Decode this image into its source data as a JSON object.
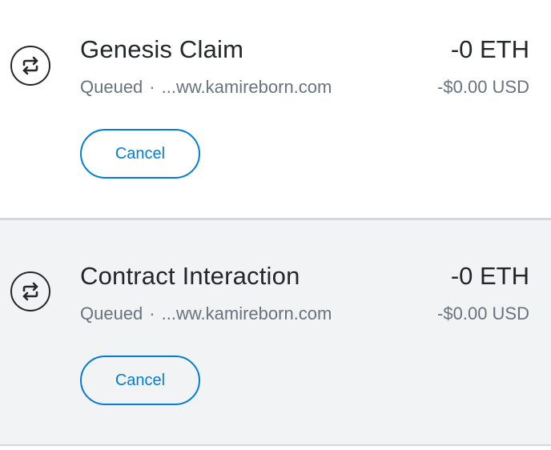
{
  "transactions": [
    {
      "title": "Genesis Claim",
      "status": "Queued",
      "separator": "·",
      "origin": "...ww.kamireborn.com",
      "amount": "-0 ETH",
      "fiat": "-$0.00 USD",
      "cancel_label": "Cancel",
      "icon": "swap-arrows-icon"
    },
    {
      "title": "Contract Interaction",
      "status": "Queued",
      "separator": "·",
      "origin": "...ww.kamireborn.com",
      "amount": "-0 ETH",
      "fiat": "-$0.00 USD",
      "cancel_label": "Cancel",
      "icon": "swap-arrows-icon"
    }
  ],
  "colors": {
    "accent": "#037dd6",
    "text_primary": "#24272a",
    "text_secondary": "#6a737d",
    "selected_bg": "#f2f3f4",
    "divider": "#d6d9dc"
  }
}
